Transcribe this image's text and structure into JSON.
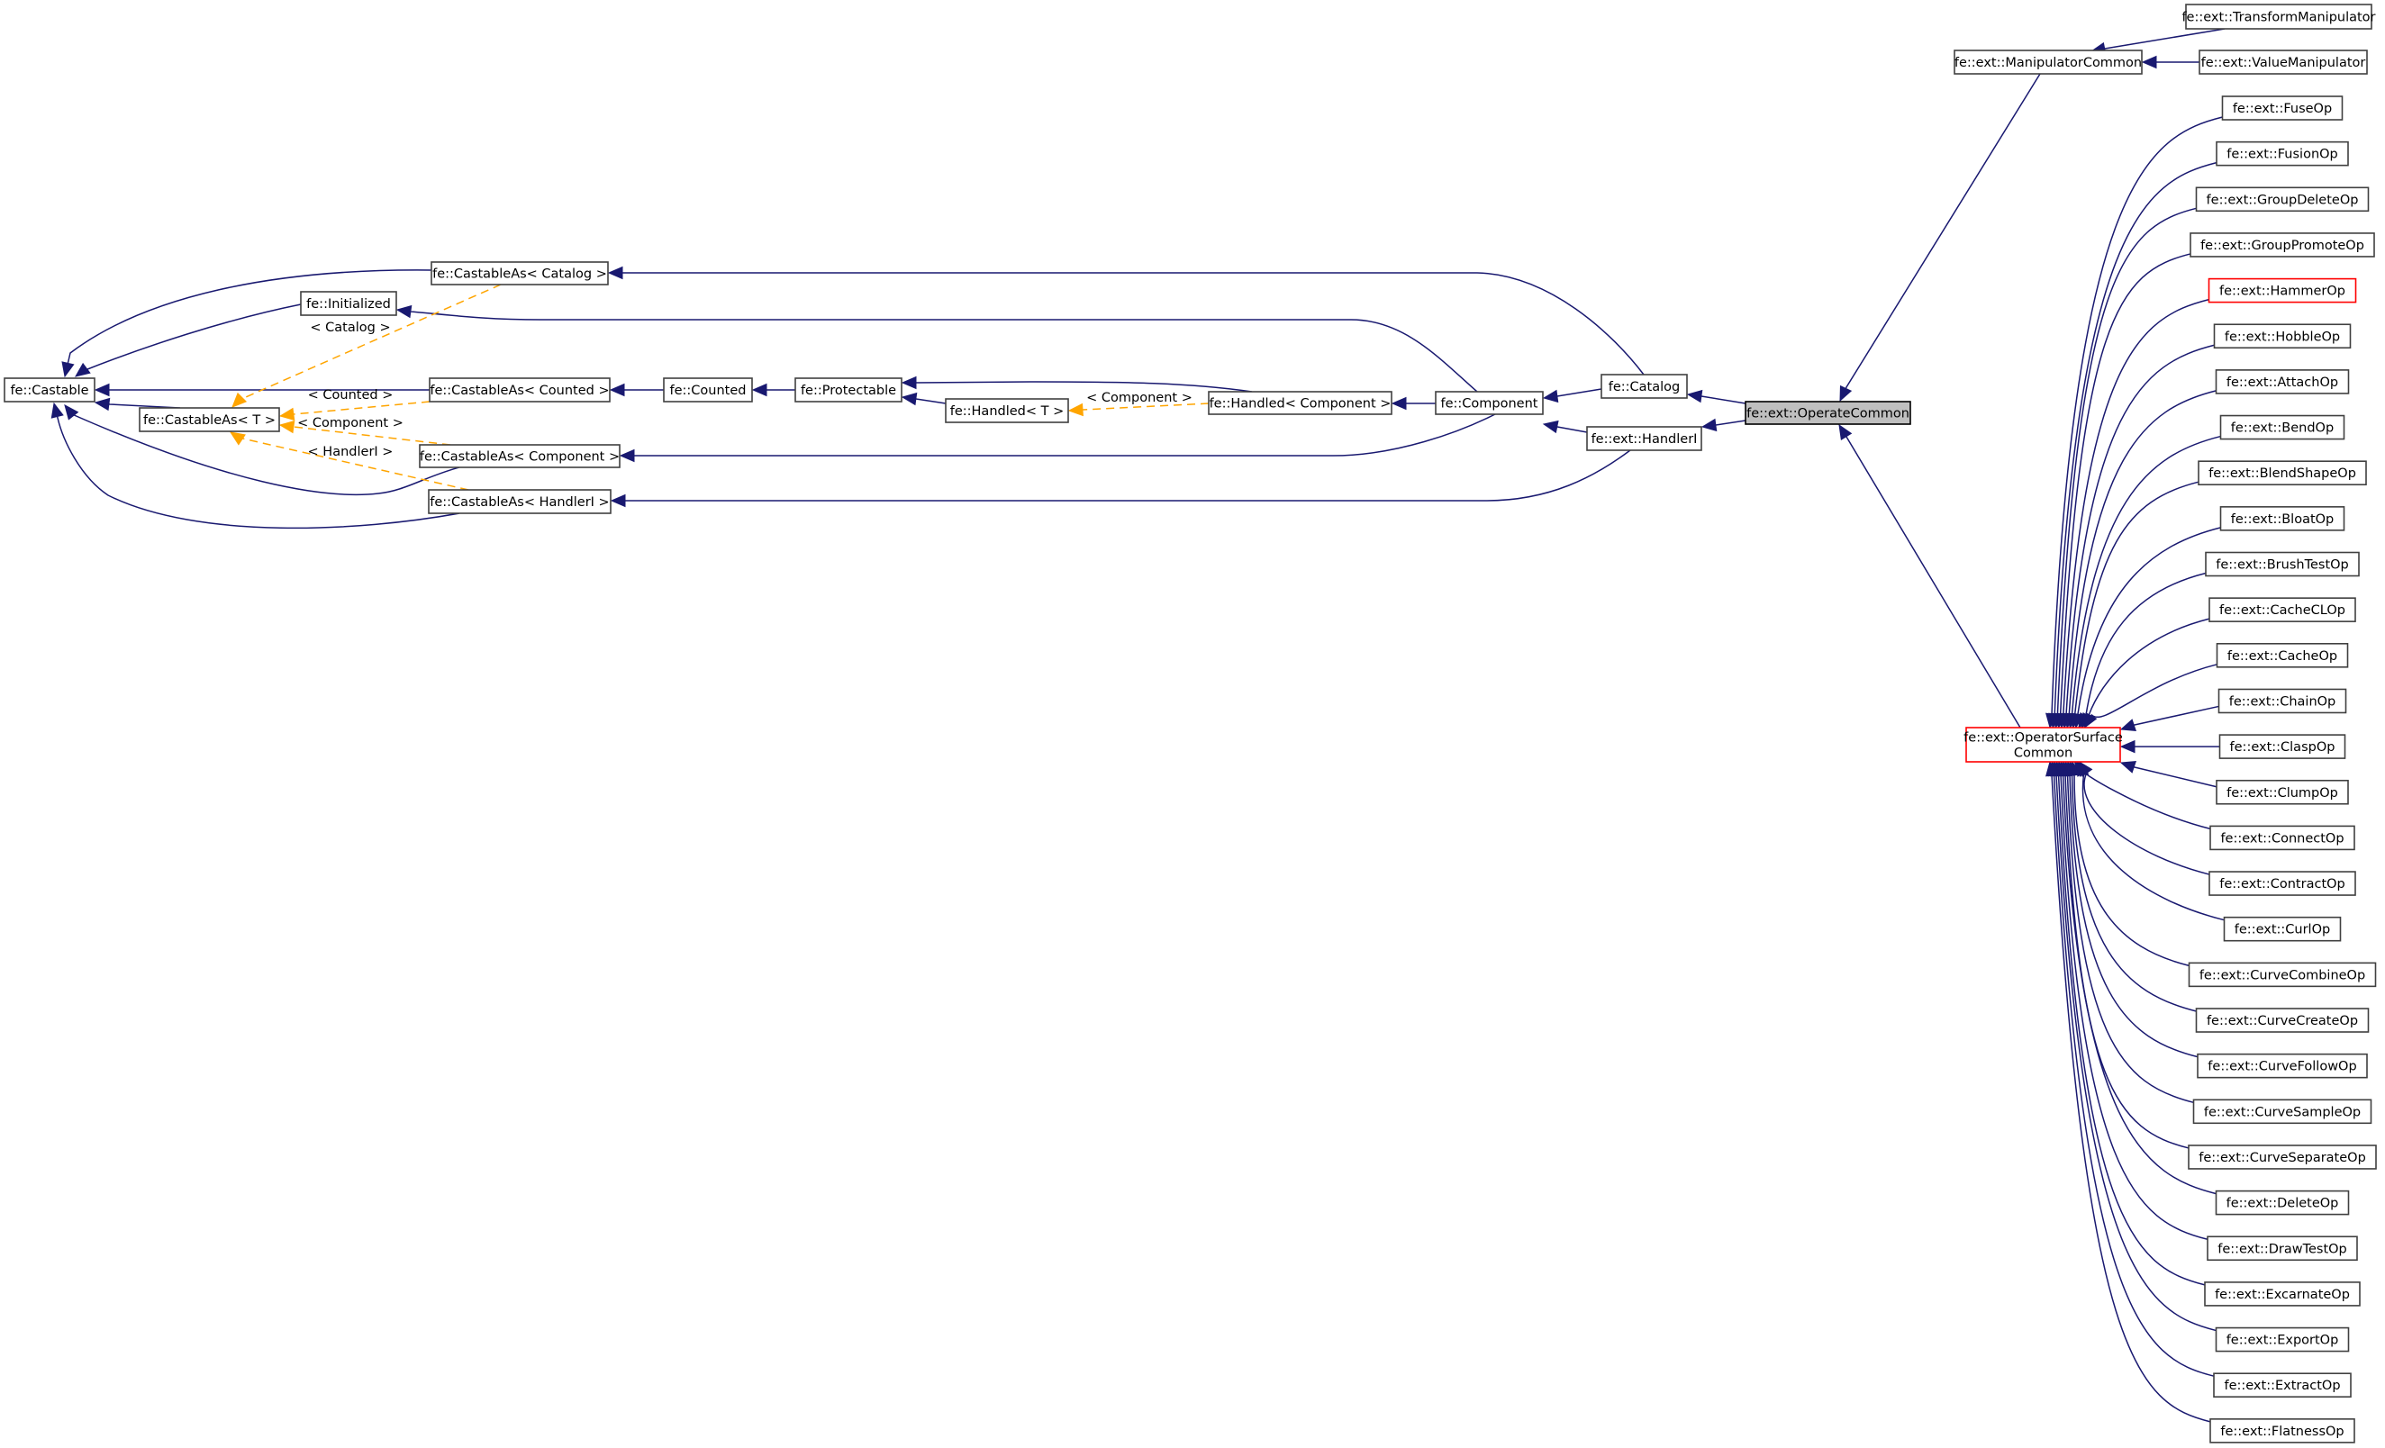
{
  "diagram": {
    "type": "class-inheritance-graph",
    "focus_node": "fe::ext::OperateCommon",
    "colors": {
      "edge": "#191970",
      "template_edge": "#ffa500",
      "node_border": "#404040",
      "undocumented_border": "#ff0000",
      "focus_fill": "#bfbfbf"
    },
    "nodes": {
      "castable": {
        "label": "fe::Castable"
      },
      "castable_as_t": {
        "label": "fe::CastableAs< T >"
      },
      "initialized": {
        "label": "fe::Initialized"
      },
      "castable_as_catalog": {
        "label": "fe::CastableAs< Catalog >"
      },
      "castable_as_counted": {
        "label": "fe::CastableAs< Counted >"
      },
      "castable_as_component": {
        "label": "fe::CastableAs< Component >"
      },
      "castable_as_handleri": {
        "label": "fe::CastableAs< HandlerI >"
      },
      "counted": {
        "label": "fe::Counted"
      },
      "protectable": {
        "label": "fe::Protectable"
      },
      "handled_t": {
        "label": "fe::Handled< T >"
      },
      "handled_component": {
        "label": "fe::Handled< Component >"
      },
      "component": {
        "label": "fe::Component"
      },
      "catalog": {
        "label": "fe::Catalog"
      },
      "handleri": {
        "label": "fe::ext::HandlerI"
      },
      "operate_common": {
        "label": "fe::ext::OperateCommon"
      },
      "manipulator_common": {
        "label": "fe::ext::ManipulatorCommon"
      },
      "transform_manipulator": {
        "label": "fe::ext::TransformManipulator"
      },
      "value_manipulator": {
        "label": "fe::ext::ValueManipulator"
      },
      "operator_surface_common": {
        "label": "fe::ext::OperatorSurface\nCommon",
        "label_line1": "fe::ext::OperatorSurface",
        "label_line2": "Common"
      }
    },
    "template_labels": {
      "catalog": "< Catalog >",
      "counted": "< Counted >",
      "component": "< Component >",
      "handleri": "< HandlerI >",
      "handled_component": "< Component >"
    },
    "operator_ops": [
      {
        "label": "fe::ext::FuseOp"
      },
      {
        "label": "fe::ext::FusionOp"
      },
      {
        "label": "fe::ext::GroupDeleteOp"
      },
      {
        "label": "fe::ext::GroupPromoteOp"
      },
      {
        "label": "fe::ext::HammerOp",
        "undocumented": true
      },
      {
        "label": "fe::ext::HobbleOp"
      },
      {
        "label": "fe::ext::AttachOp"
      },
      {
        "label": "fe::ext::BendOp"
      },
      {
        "label": "fe::ext::BlendShapeOp"
      },
      {
        "label": "fe::ext::BloatOp"
      },
      {
        "label": "fe::ext::BrushTestOp"
      },
      {
        "label": "fe::ext::CacheCLOp"
      },
      {
        "label": "fe::ext::CacheOp"
      },
      {
        "label": "fe::ext::ChainOp"
      },
      {
        "label": "fe::ext::ClaspOp"
      },
      {
        "label": "fe::ext::ClumpOp"
      },
      {
        "label": "fe::ext::ConnectOp"
      },
      {
        "label": "fe::ext::ContractOp"
      },
      {
        "label": "fe::ext::CurlOp"
      },
      {
        "label": "fe::ext::CurveCombineOp"
      },
      {
        "label": "fe::ext::CurveCreateOp"
      },
      {
        "label": "fe::ext::CurveFollowOp"
      },
      {
        "label": "fe::ext::CurveSampleOp"
      },
      {
        "label": "fe::ext::CurveSeparateOp"
      },
      {
        "label": "fe::ext::DeleteOp"
      },
      {
        "label": "fe::ext::DrawTestOp"
      },
      {
        "label": "fe::ext::ExcarnateOp"
      },
      {
        "label": "fe::ext::ExportOp"
      },
      {
        "label": "fe::ext::ExtractOp"
      },
      {
        "label": "fe::ext::FlatnessOp"
      }
    ]
  }
}
